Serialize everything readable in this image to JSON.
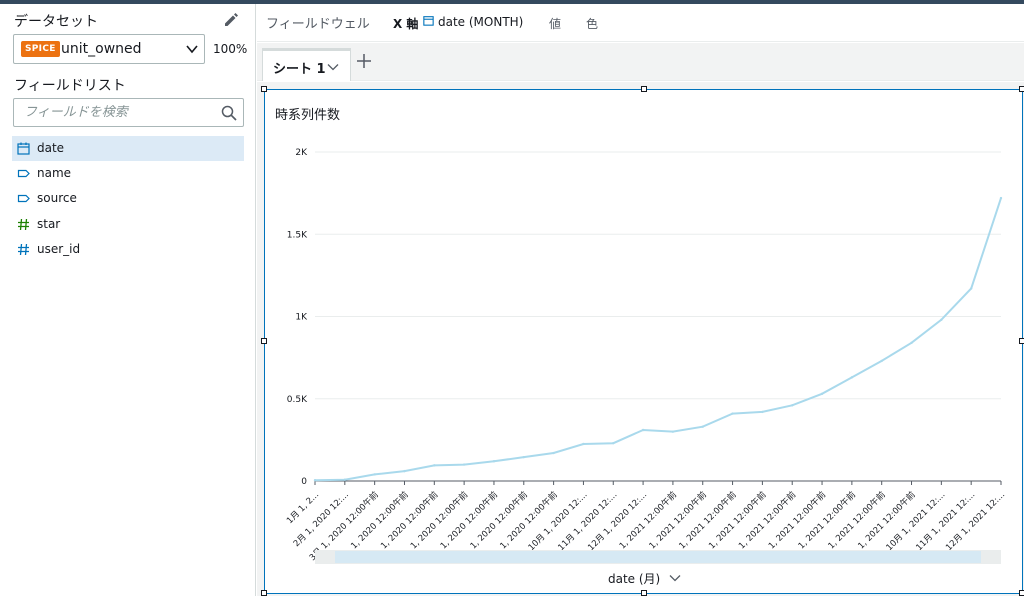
{
  "left_panel": {
    "dataset_title": "データセット",
    "dataset": {
      "badge": "SPICE",
      "name": "unit_owned",
      "percent": "100%"
    },
    "field_list_title": "フィールドリスト",
    "search_placeholder": "フィールドを検索",
    "fields": [
      {
        "label": "date",
        "icon": "calendar-icon",
        "selected": true
      },
      {
        "label": "name",
        "icon": "dimension-tag-icon",
        "selected": false
      },
      {
        "label": "source",
        "icon": "dimension-tag-icon",
        "selected": false
      },
      {
        "label": "star",
        "icon": "measure-hash-icon",
        "selected": false
      },
      {
        "label": "user_id",
        "icon": "measure-hash-icon",
        "selected": false
      }
    ]
  },
  "field_wells": {
    "title": "フィールドウェル",
    "x_axis_label": "X 軸",
    "x_axis_field": "date (MONTH)",
    "value_label": "値",
    "color_label": "色"
  },
  "sheets": {
    "tabs": [
      {
        "label": "シート 1"
      }
    ]
  },
  "visual": {
    "title": "時系列件数",
    "x_axis_title": "date (月)"
  },
  "colors": {
    "line": "#a9d9ec",
    "accent": "#0073bb",
    "spice": "#ec7211",
    "selected": "#dceaf6",
    "measure": "#1d8102"
  },
  "chart_data": {
    "type": "line",
    "title": "時系列件数",
    "xlabel": "date (月)",
    "ylabel": "",
    "ylim": [
      0,
      2000
    ],
    "yticks": [
      {
        "value": 0,
        "label": "0"
      },
      {
        "value": 500,
        "label": "0.5K"
      },
      {
        "value": 1000,
        "label": "1K"
      },
      {
        "value": 1500,
        "label": "1.5K"
      },
      {
        "value": 2000,
        "label": "2K"
      }
    ],
    "categories": [
      "1月 1, 2...",
      "2月 1, 2020 12:...",
      "3月 1, 2020 12:00午前",
      "1, 2020 12:00午前",
      "1, 2020 12:00午前",
      "1, 2020 12:00午前",
      "1, 2020 12:00午前",
      "1, 2020 12:00午前",
      "1, 2020 12:00午前",
      "10月 1, 2020 12:...",
      "11月 1, 2020 12:...",
      "12月 1, 2020 12:...",
      "1, 2021 12:00午前",
      "1, 2021 12:00午前",
      "1, 2021 12:00午前",
      "1, 2021 12:00午前",
      "1, 2021 12:00午前",
      "1, 2021 12:00午前",
      "1, 2021 12:00午前",
      "1, 2021 12:00午前",
      "1, 2021 12:00午前",
      "10月 1, 2021 12:...",
      "11月 1, 2021 12:...",
      "12月 1, 2021 12:..."
    ],
    "values": [
      5,
      8,
      40,
      60,
      95,
      100,
      120,
      145,
      170,
      225,
      230,
      310,
      300,
      330,
      410,
      420,
      460,
      530,
      630,
      730,
      840,
      980,
      1170,
      1720
    ]
  }
}
